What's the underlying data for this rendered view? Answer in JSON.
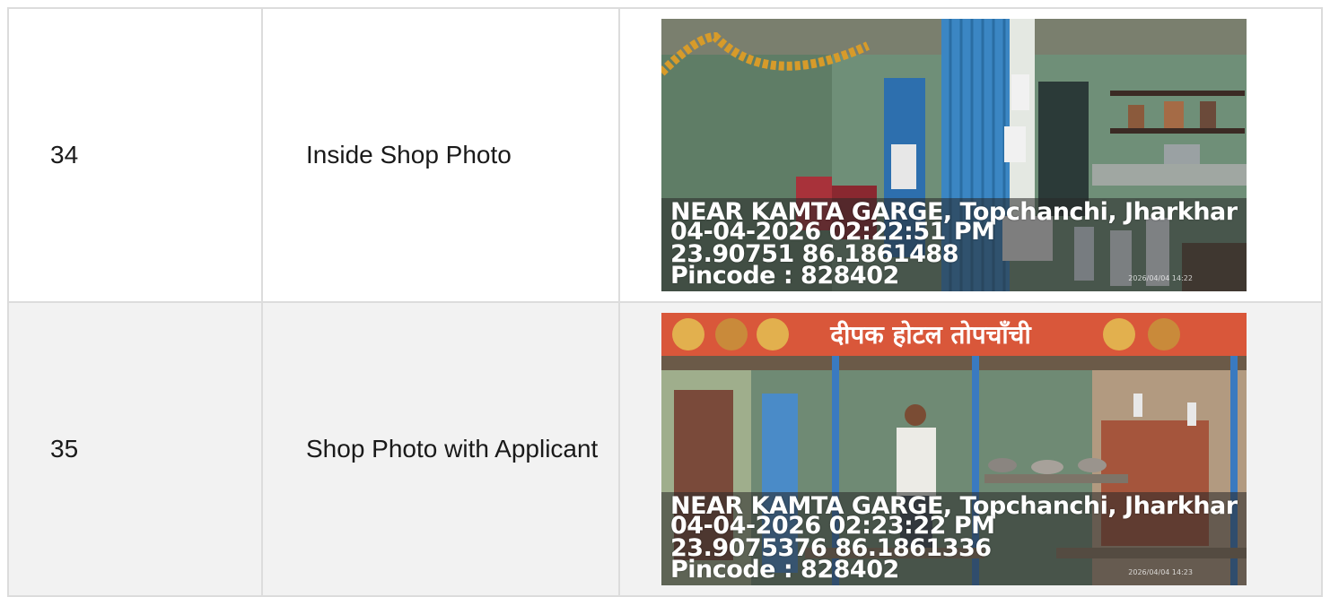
{
  "rows": [
    {
      "number": "34",
      "label": "Inside Shop Photo",
      "photo": {
        "location_line": "NEAR KAMTA GARGE, Topchanchi, Jharkhar",
        "datetime_line": "04-04-2026 02:22:51 PM",
        "coords_line": "23.90751 86.1861488",
        "pincode_line": "Pincode : 828402",
        "camera_timestamp": "2026/04/04 14:22"
      }
    },
    {
      "number": "35",
      "label": "Shop Photo with Applicant",
      "photo": {
        "location_line": "NEAR KAMTA GARGE, Topchanchi, Jharkhar",
        "datetime_line": "04-04-2026 02:23:22 PM",
        "coords_line": "23.9075376 86.1861336",
        "pincode_line": "Pincode : 828402",
        "camera_timestamp": "2026/04/04 14:23",
        "signboard_text": "दीपक होटल तोपचाँची"
      }
    }
  ]
}
